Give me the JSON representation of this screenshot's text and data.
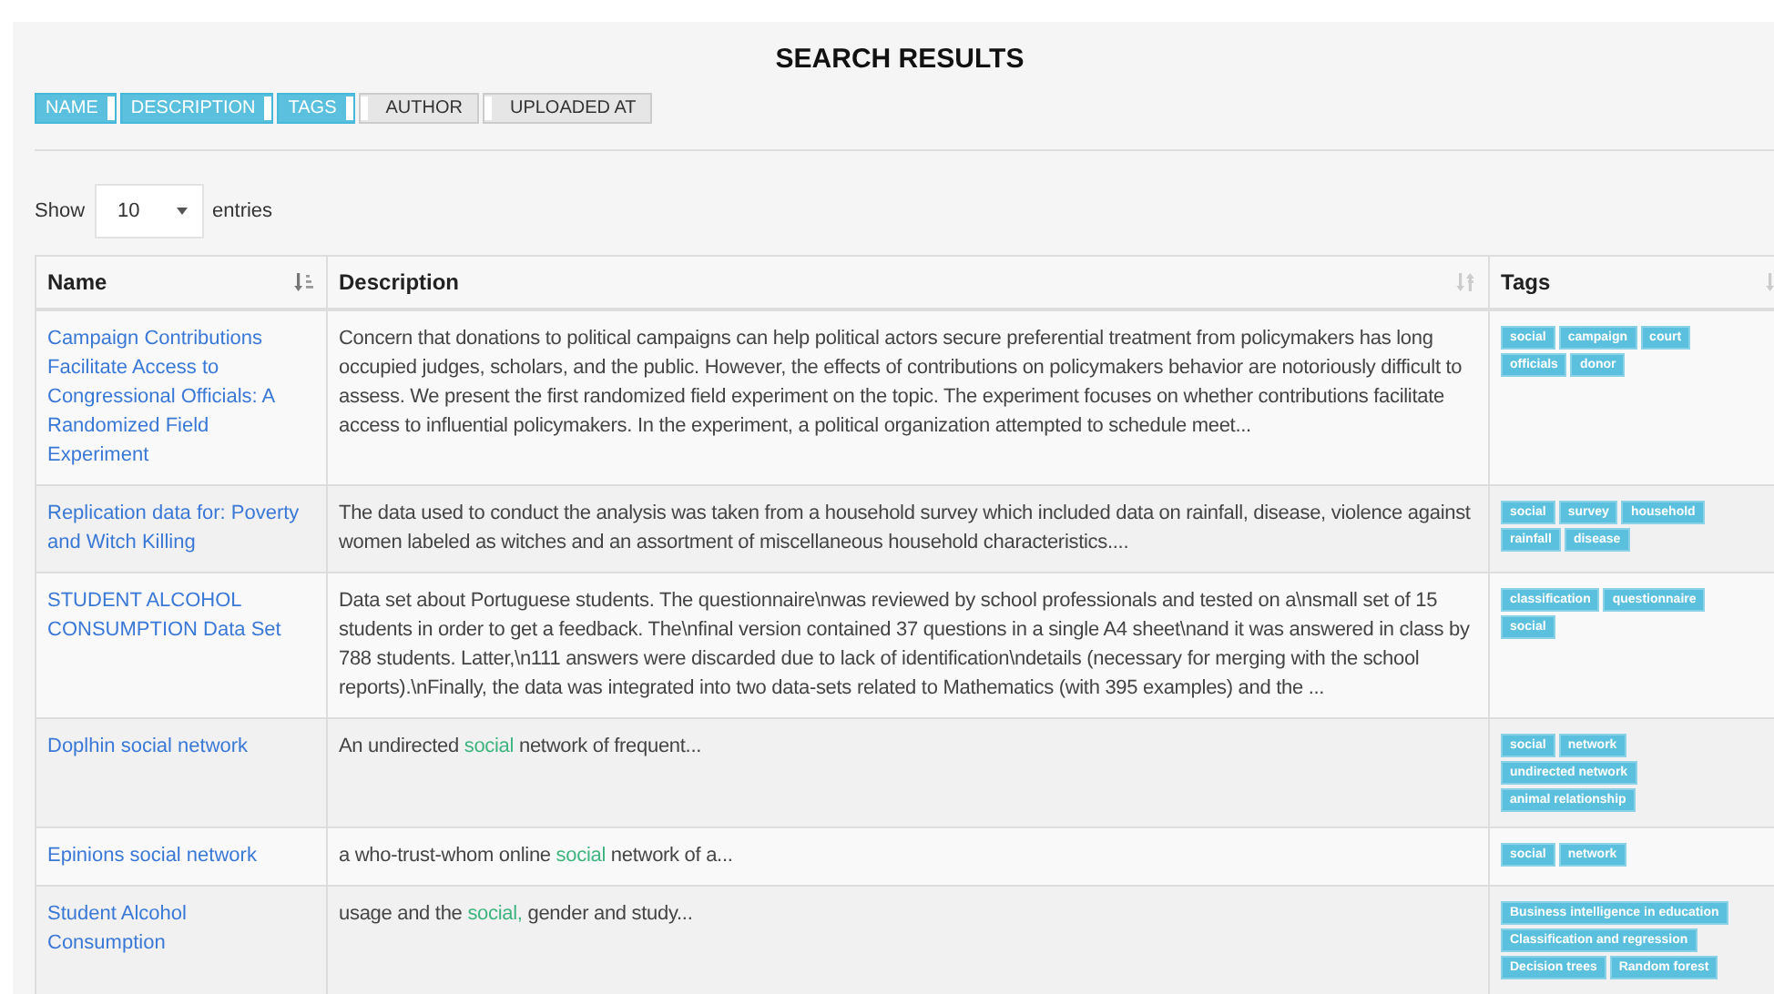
{
  "title": "SEARCH RESULTS",
  "column_toggles": [
    {
      "label": "NAME",
      "selected": true
    },
    {
      "label": "DESCRIPTION",
      "selected": true
    },
    {
      "label": "TAGS",
      "selected": true
    },
    {
      "label": "AUTHOR",
      "selected": false
    },
    {
      "label": "UPLOADED AT",
      "selected": false
    }
  ],
  "length_menu": {
    "before": "Show",
    "value": "10",
    "after": "entries"
  },
  "table": {
    "columns": [
      {
        "label": "Name",
        "sorted": true
      },
      {
        "label": "Description",
        "sorted": false
      },
      {
        "label": "Tags",
        "sorted": false
      }
    ],
    "rows": [
      {
        "name": "Campaign Contributions Facilitate Access to Congressional Officials: A Randomized Field Experiment",
        "description": [
          {
            "text": "Concern that donations to political campaigns can help political actors secure preferential treatment from policymakers has long occupied judges, scholars, and the public. However, the effects of contributions on policymakers behavior are notoriously difficult to assess. We present the first randomized field experiment on the topic. The experiment focuses on whether contributions facilitate access to influential policymakers. In the experiment, a political organization attempted to schedule meet...",
            "highlight": false
          }
        ],
        "tags": [
          "social",
          "campaign",
          "court",
          "officials",
          "donor"
        ]
      },
      {
        "name": "Replication data for: Poverty and Witch Killing",
        "description": [
          {
            "text": "The data used to conduct the analysis was taken from a household survey which included data on rainfall, disease, violence against women labeled as witches and an assortment of miscellaneous household characteristics....",
            "highlight": false
          }
        ],
        "tags": [
          "social",
          "survey",
          "household",
          "rainfall",
          "disease"
        ]
      },
      {
        "name": "STUDENT ALCOHOL CONSUMPTION Data Set",
        "description": [
          {
            "text": "Data set about Portuguese students. The questionnaire\\nwas reviewed by school professionals and tested on a\\nsmall set of 15 students in order to get a feedback. The\\nfinal version contained 37 questions in a single A4 sheet\\nand it was answered in class by 788 students. Latter,\\n111 answers were discarded due to lack of identification\\ndetails (necessary for merging with the school reports).\\nFinally, the data was integrated into two data-sets related to Mathematics (with 395 examples) and the ...",
            "highlight": false
          }
        ],
        "tags": [
          "classification",
          "questionnaire",
          "social"
        ]
      },
      {
        "name": "Doplhin social network",
        "description": [
          {
            "text": "An undirected ",
            "highlight": false
          },
          {
            "text": "social",
            "highlight": true
          },
          {
            "text": " network of frequent...",
            "highlight": false
          }
        ],
        "tags": [
          "social",
          "network",
          "undirected network",
          "animal relationship"
        ]
      },
      {
        "name": "Epinions social network",
        "description": [
          {
            "text": "a who-trust-whom online ",
            "highlight": false
          },
          {
            "text": "social",
            "highlight": true
          },
          {
            "text": " network of a...",
            "highlight": false
          }
        ],
        "tags": [
          "social",
          "network"
        ]
      },
      {
        "name": "Student Alcohol Consumption",
        "description": [
          {
            "text": "usage and the ",
            "highlight": false
          },
          {
            "text": "social,",
            "highlight": true
          },
          {
            "text": " gender and study...",
            "highlight": false
          }
        ],
        "tags": [
          "Business intelligence in education",
          "Classification and regression",
          "Decision trees",
          "Random forest"
        ]
      }
    ]
  }
}
